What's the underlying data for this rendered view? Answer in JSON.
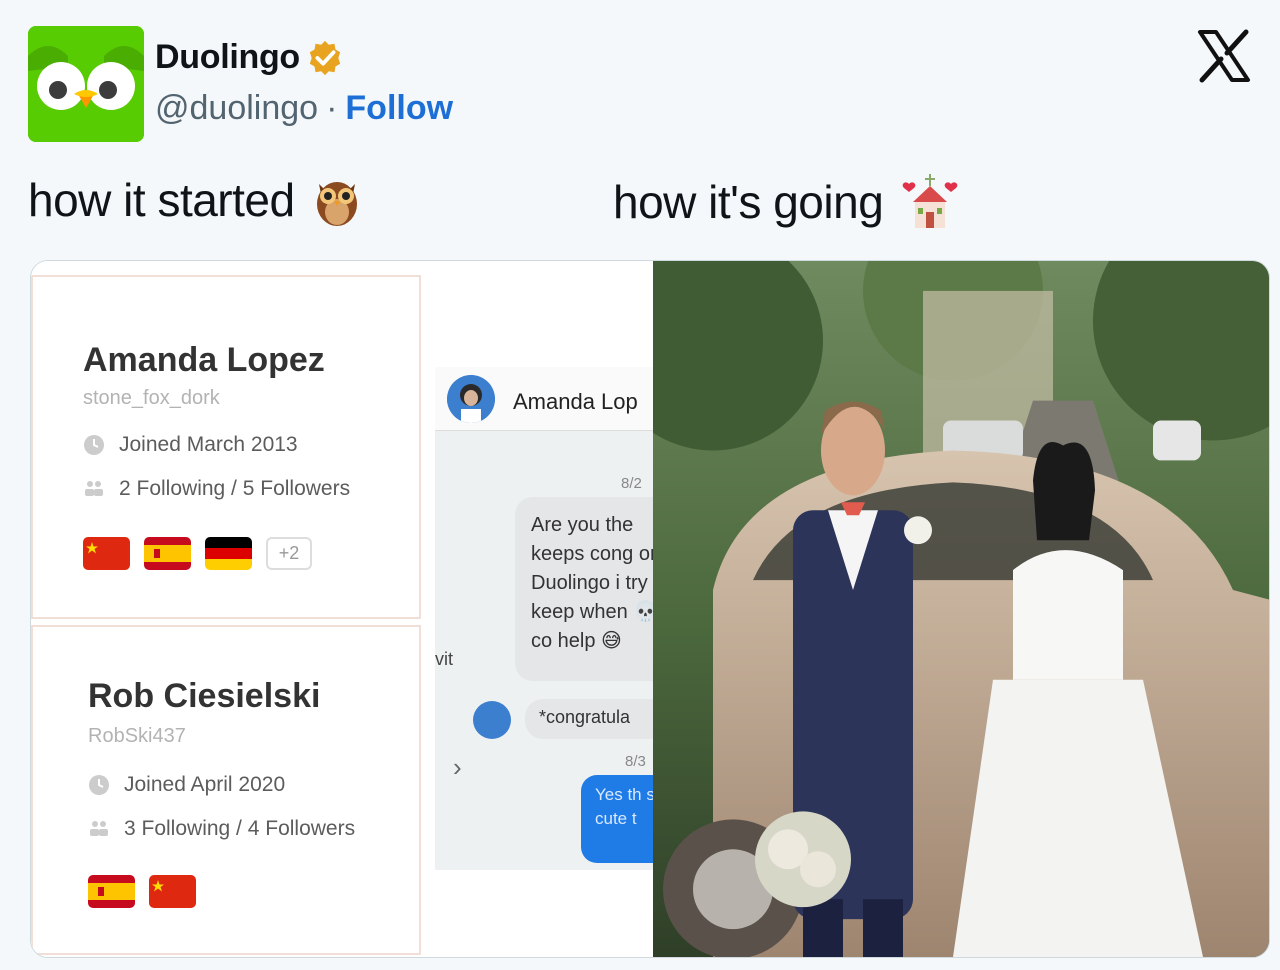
{
  "author": {
    "name": "Duolingo",
    "handle": "@duolingo",
    "separator": "·",
    "follow_label": "Follow",
    "verified_color": "#f4b400",
    "avatar_color": "#58cc02"
  },
  "tweet": {
    "left_text": "how it started",
    "left_emoji": "owl",
    "right_text": "how it's going",
    "right_emoji": "wedding-chapel"
  },
  "media": {
    "profile_cards": [
      {
        "name": "Amanda Lopez",
        "username": "stone_fox_dork",
        "joined": "Joined March 2013",
        "follow_stats": "2 Following / 5 Followers",
        "flags": [
          "china",
          "spain",
          "germany"
        ],
        "extra_flags": "+2"
      },
      {
        "name": "Rob Ciesielski",
        "username": "RobSki437",
        "joined": "Joined April 2020",
        "follow_stats": "3 Following / 4 Followers",
        "flags": [
          "spain",
          "china"
        ]
      }
    ],
    "chat": {
      "contact_name": "Amanda Lop",
      "date1": "8/2",
      "incoming_message": "Are you the keeps cong on Duolingo i try to keep when 💀 co help 😅",
      "incoming_message_2": "*congratula",
      "date2": "8/3",
      "outgoing_message": "Yes th sure i cute t",
      "left_fragment": "vit",
      "chevron": "›"
    },
    "photo_description": "wedding-couple-photo"
  },
  "x_logo": "x-logo"
}
